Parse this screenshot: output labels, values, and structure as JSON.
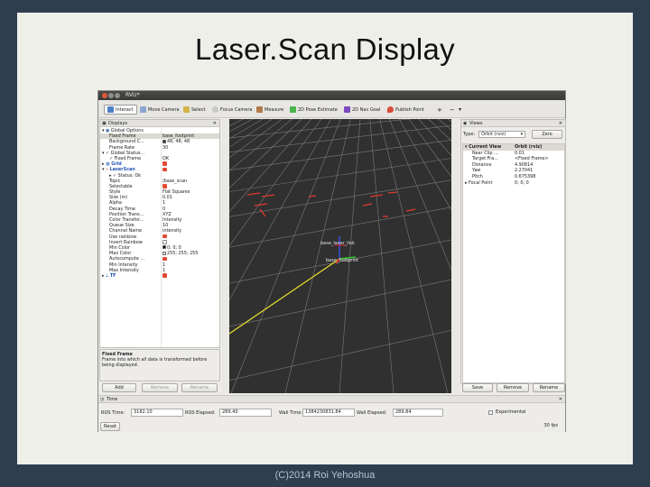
{
  "slide": {
    "title": "Laser.Scan Display",
    "footer": "(C)2014 Roi Yehoshua"
  },
  "window": {
    "title": "RViz*"
  },
  "toolbar": {
    "items": [
      {
        "label": "Interact",
        "icon": "interact-icon",
        "active": true
      },
      {
        "label": "Move Camera",
        "icon": "move-camera-icon"
      },
      {
        "label": "Select",
        "icon": "select-icon"
      },
      {
        "label": "Focus Camera",
        "icon": "focus-camera-icon"
      },
      {
        "label": "Measure",
        "icon": "measure-icon"
      },
      {
        "label": "2D Pose Estimate",
        "icon": "pose-estimate-icon"
      },
      {
        "label": "2D Nav Goal",
        "icon": "nav-goal-icon"
      },
      {
        "label": "Publish Point",
        "icon": "publish-point-icon"
      }
    ],
    "extra_icons": [
      "+",
      "−",
      "▾"
    ]
  },
  "displays": {
    "title": "Displays",
    "rows": [
      {
        "k": "Global Options",
        "v": "",
        "indent": 0,
        "arrow": "▾",
        "ico": "gear"
      },
      {
        "k": "Fixed Frame",
        "v": "base_footprint",
        "indent": 1,
        "sel": true
      },
      {
        "k": "Background C...",
        "v": "48; 48; 48",
        "indent": 1,
        "swatch": "#303030"
      },
      {
        "k": "Frame Rate",
        "v": "30",
        "indent": 1
      },
      {
        "k": "Global Status...",
        "v": "",
        "indent": 0,
        "arrow": "▾",
        "ico": "check"
      },
      {
        "k": "Fixed Frame",
        "v": "OK",
        "indent": 1,
        "ico": "check"
      },
      {
        "k": "Grid",
        "v": "",
        "indent": 0,
        "arrow": "▸",
        "ico": "grid",
        "checked": true,
        "blue": true
      },
      {
        "k": "LaserScan",
        "v": "",
        "indent": 0,
        "arrow": "▾",
        "ico": "laser",
        "checked": true,
        "blue": true
      },
      {
        "k": "Status: Ok",
        "v": "",
        "indent": 1,
        "arrow": "▸",
        "ico": "check"
      },
      {
        "k": "Topic",
        "v": "/base_scan",
        "indent": 1
      },
      {
        "k": "Selectable",
        "v": "",
        "indent": 1,
        "checked": true
      },
      {
        "k": "Style",
        "v": "Flat Squares",
        "indent": 1
      },
      {
        "k": "Size (m)",
        "v": "0.01",
        "indent": 1
      },
      {
        "k": "Alpha",
        "v": "1",
        "indent": 1
      },
      {
        "k": "Decay Time",
        "v": "0",
        "indent": 1
      },
      {
        "k": "Position Trans...",
        "v": "XYZ",
        "indent": 1
      },
      {
        "k": "Color Transfor...",
        "v": "Intensity",
        "indent": 1
      },
      {
        "k": "Queue Size",
        "v": "10",
        "indent": 1
      },
      {
        "k": "Channel Name",
        "v": "intensity",
        "indent": 1
      },
      {
        "k": "Use rainbow",
        "v": "",
        "indent": 1,
        "checked": true
      },
      {
        "k": "Invert Rainbow",
        "v": "",
        "indent": 1,
        "unchecked": true
      },
      {
        "k": "Min Color",
        "v": "0; 0; 0",
        "indent": 1,
        "swatch": "#000000"
      },
      {
        "k": "Max Color",
        "v": "255; 255; 255",
        "indent": 1,
        "swatch": "#ffffff"
      },
      {
        "k": "Autocompute ...",
        "v": "",
        "indent": 1,
        "checked": true
      },
      {
        "k": "Min Intensity",
        "v": "1",
        "indent": 1
      },
      {
        "k": "Max Intensity",
        "v": "1",
        "indent": 1
      },
      {
        "k": "TF",
        "v": "",
        "indent": 0,
        "arrow": "▸",
        "ico": "tf",
        "checked": true,
        "blue": true
      }
    ],
    "help_title": "Fixed Frame",
    "help_text": "Frame into which all data is transformed before being displayed.",
    "buttons": {
      "add": "Add",
      "remove": "Remove",
      "rename": "Rename"
    }
  },
  "scene": {
    "labels": {
      "laser": "base_laser_link",
      "footprint": "base_footprint"
    },
    "colors": {
      "background": "#303030",
      "grid": "#7a7a7a",
      "scan": "#e03a2c",
      "ray": "#e6e02a",
      "axis_green": "#31c831",
      "axis_blue": "#3a4cd6",
      "axis_red": "#e02020"
    }
  },
  "views": {
    "title": "Views",
    "type_label": "Type:",
    "type_value": "Orbit (rviz)",
    "zero": "Zero",
    "rows": [
      {
        "k": "Current View",
        "v": "Orbit (rviz)",
        "hdr": true,
        "arrow": "▾"
      },
      {
        "k": "Near Clip ...",
        "v": "0.01"
      },
      {
        "k": "Target Fra...",
        "v": "<Fixed Frame>"
      },
      {
        "k": "Distance",
        "v": "4.90814"
      },
      {
        "k": "Yaw",
        "v": "2.27041"
      },
      {
        "k": "Pitch",
        "v": "0.675398"
      },
      {
        "k": "Focal Point",
        "v": "0; 0; 0",
        "arrow": "▸"
      }
    ],
    "buttons": {
      "save": "Save",
      "remove": "Remove",
      "rename": "Rename"
    }
  },
  "time": {
    "title": "Time",
    "ros_time_label": "ROS Time:",
    "ros_time": "3182.10",
    "ros_elapsed_label": "ROS Elapsed:",
    "ros_elapsed": "289.40",
    "wall_time_label": "Wall Time:",
    "wall_time": "1384230831.84",
    "wall_elapsed_label": "Wall Elapsed:",
    "wall_elapsed": "289.84",
    "experimental": "Experimental",
    "reset": "Reset",
    "fps": "30 fps"
  }
}
